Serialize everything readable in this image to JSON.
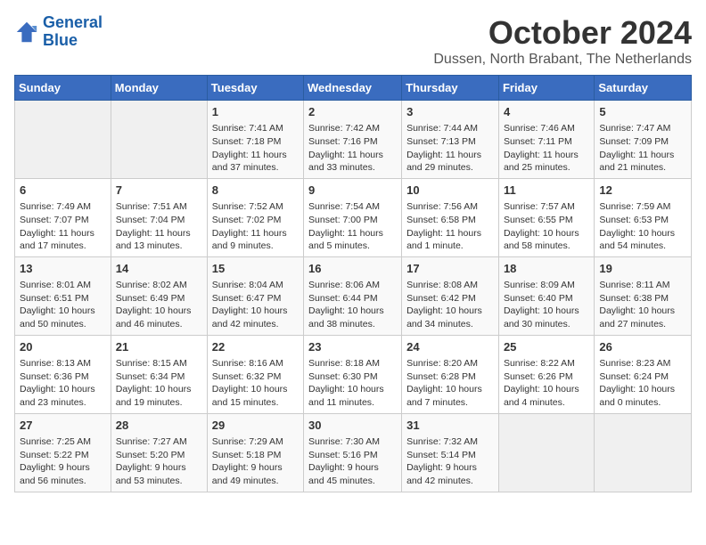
{
  "header": {
    "logo_line1": "General",
    "logo_line2": "Blue",
    "month_title": "October 2024",
    "subtitle": "Dussen, North Brabant, The Netherlands"
  },
  "days_of_week": [
    "Sunday",
    "Monday",
    "Tuesday",
    "Wednesday",
    "Thursday",
    "Friday",
    "Saturday"
  ],
  "weeks": [
    [
      {
        "day": "",
        "sunrise": "",
        "sunset": "",
        "daylight": "",
        "empty": true
      },
      {
        "day": "",
        "sunrise": "",
        "sunset": "",
        "daylight": "",
        "empty": true
      },
      {
        "day": "1",
        "sunrise": "Sunrise: 7:41 AM",
        "sunset": "Sunset: 7:18 PM",
        "daylight": "Daylight: 11 hours and 37 minutes."
      },
      {
        "day": "2",
        "sunrise": "Sunrise: 7:42 AM",
        "sunset": "Sunset: 7:16 PM",
        "daylight": "Daylight: 11 hours and 33 minutes."
      },
      {
        "day": "3",
        "sunrise": "Sunrise: 7:44 AM",
        "sunset": "Sunset: 7:13 PM",
        "daylight": "Daylight: 11 hours and 29 minutes."
      },
      {
        "day": "4",
        "sunrise": "Sunrise: 7:46 AM",
        "sunset": "Sunset: 7:11 PM",
        "daylight": "Daylight: 11 hours and 25 minutes."
      },
      {
        "day": "5",
        "sunrise": "Sunrise: 7:47 AM",
        "sunset": "Sunset: 7:09 PM",
        "daylight": "Daylight: 11 hours and 21 minutes."
      }
    ],
    [
      {
        "day": "6",
        "sunrise": "Sunrise: 7:49 AM",
        "sunset": "Sunset: 7:07 PM",
        "daylight": "Daylight: 11 hours and 17 minutes."
      },
      {
        "day": "7",
        "sunrise": "Sunrise: 7:51 AM",
        "sunset": "Sunset: 7:04 PM",
        "daylight": "Daylight: 11 hours and 13 minutes."
      },
      {
        "day": "8",
        "sunrise": "Sunrise: 7:52 AM",
        "sunset": "Sunset: 7:02 PM",
        "daylight": "Daylight: 11 hours and 9 minutes."
      },
      {
        "day": "9",
        "sunrise": "Sunrise: 7:54 AM",
        "sunset": "Sunset: 7:00 PM",
        "daylight": "Daylight: 11 hours and 5 minutes."
      },
      {
        "day": "10",
        "sunrise": "Sunrise: 7:56 AM",
        "sunset": "Sunset: 6:58 PM",
        "daylight": "Daylight: 11 hours and 1 minute."
      },
      {
        "day": "11",
        "sunrise": "Sunrise: 7:57 AM",
        "sunset": "Sunset: 6:55 PM",
        "daylight": "Daylight: 10 hours and 58 minutes."
      },
      {
        "day": "12",
        "sunrise": "Sunrise: 7:59 AM",
        "sunset": "Sunset: 6:53 PM",
        "daylight": "Daylight: 10 hours and 54 minutes."
      }
    ],
    [
      {
        "day": "13",
        "sunrise": "Sunrise: 8:01 AM",
        "sunset": "Sunset: 6:51 PM",
        "daylight": "Daylight: 10 hours and 50 minutes."
      },
      {
        "day": "14",
        "sunrise": "Sunrise: 8:02 AM",
        "sunset": "Sunset: 6:49 PM",
        "daylight": "Daylight: 10 hours and 46 minutes."
      },
      {
        "day": "15",
        "sunrise": "Sunrise: 8:04 AM",
        "sunset": "Sunset: 6:47 PM",
        "daylight": "Daylight: 10 hours and 42 minutes."
      },
      {
        "day": "16",
        "sunrise": "Sunrise: 8:06 AM",
        "sunset": "Sunset: 6:44 PM",
        "daylight": "Daylight: 10 hours and 38 minutes."
      },
      {
        "day": "17",
        "sunrise": "Sunrise: 8:08 AM",
        "sunset": "Sunset: 6:42 PM",
        "daylight": "Daylight: 10 hours and 34 minutes."
      },
      {
        "day": "18",
        "sunrise": "Sunrise: 8:09 AM",
        "sunset": "Sunset: 6:40 PM",
        "daylight": "Daylight: 10 hours and 30 minutes."
      },
      {
        "day": "19",
        "sunrise": "Sunrise: 8:11 AM",
        "sunset": "Sunset: 6:38 PM",
        "daylight": "Daylight: 10 hours and 27 minutes."
      }
    ],
    [
      {
        "day": "20",
        "sunrise": "Sunrise: 8:13 AM",
        "sunset": "Sunset: 6:36 PM",
        "daylight": "Daylight: 10 hours and 23 minutes."
      },
      {
        "day": "21",
        "sunrise": "Sunrise: 8:15 AM",
        "sunset": "Sunset: 6:34 PM",
        "daylight": "Daylight: 10 hours and 19 minutes."
      },
      {
        "day": "22",
        "sunrise": "Sunrise: 8:16 AM",
        "sunset": "Sunset: 6:32 PM",
        "daylight": "Daylight: 10 hours and 15 minutes."
      },
      {
        "day": "23",
        "sunrise": "Sunrise: 8:18 AM",
        "sunset": "Sunset: 6:30 PM",
        "daylight": "Daylight: 10 hours and 11 minutes."
      },
      {
        "day": "24",
        "sunrise": "Sunrise: 8:20 AM",
        "sunset": "Sunset: 6:28 PM",
        "daylight": "Daylight: 10 hours and 7 minutes."
      },
      {
        "day": "25",
        "sunrise": "Sunrise: 8:22 AM",
        "sunset": "Sunset: 6:26 PM",
        "daylight": "Daylight: 10 hours and 4 minutes."
      },
      {
        "day": "26",
        "sunrise": "Sunrise: 8:23 AM",
        "sunset": "Sunset: 6:24 PM",
        "daylight": "Daylight: 10 hours and 0 minutes."
      }
    ],
    [
      {
        "day": "27",
        "sunrise": "Sunrise: 7:25 AM",
        "sunset": "Sunset: 5:22 PM",
        "daylight": "Daylight: 9 hours and 56 minutes."
      },
      {
        "day": "28",
        "sunrise": "Sunrise: 7:27 AM",
        "sunset": "Sunset: 5:20 PM",
        "daylight": "Daylight: 9 hours and 53 minutes."
      },
      {
        "day": "29",
        "sunrise": "Sunrise: 7:29 AM",
        "sunset": "Sunset: 5:18 PM",
        "daylight": "Daylight: 9 hours and 49 minutes."
      },
      {
        "day": "30",
        "sunrise": "Sunrise: 7:30 AM",
        "sunset": "Sunset: 5:16 PM",
        "daylight": "Daylight: 9 hours and 45 minutes."
      },
      {
        "day": "31",
        "sunrise": "Sunrise: 7:32 AM",
        "sunset": "Sunset: 5:14 PM",
        "daylight": "Daylight: 9 hours and 42 minutes."
      },
      {
        "day": "",
        "sunrise": "",
        "sunset": "",
        "daylight": "",
        "empty": true
      },
      {
        "day": "",
        "sunrise": "",
        "sunset": "",
        "daylight": "",
        "empty": true
      }
    ]
  ]
}
